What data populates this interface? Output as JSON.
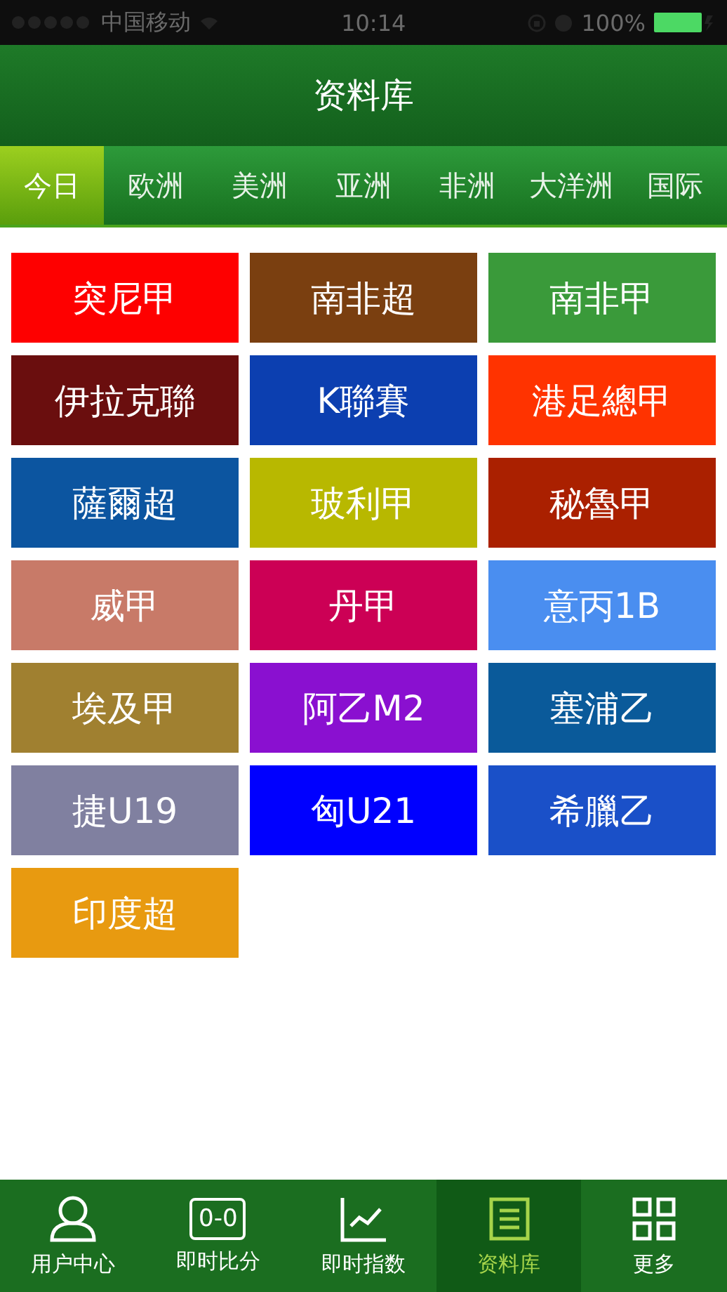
{
  "status_bar": {
    "carrier": "中国移动",
    "time": "10:14",
    "battery": "100%"
  },
  "header": {
    "title": "资料库"
  },
  "tabs": [
    {
      "label": "今日",
      "selected": true
    },
    {
      "label": "欧洲",
      "selected": false
    },
    {
      "label": "美洲",
      "selected": false
    },
    {
      "label": "亚洲",
      "selected": false
    },
    {
      "label": "非洲",
      "selected": false
    },
    {
      "label": "大洋洲",
      "selected": false
    },
    {
      "label": "国际",
      "selected": false
    }
  ],
  "leagues": [
    {
      "name": "突尼甲",
      "color": "#fe0000"
    },
    {
      "name": "南非超",
      "color": "#7a3f10"
    },
    {
      "name": "南非甲",
      "color": "#3a9a3a"
    },
    {
      "name": "伊拉克聯",
      "color": "#6a0e0e"
    },
    {
      "name": "K聯賽",
      "color": "#0c3fb0"
    },
    {
      "name": "港足總甲",
      "color": "#ff3300"
    },
    {
      "name": "薩爾超",
      "color": "#0c55a0"
    },
    {
      "name": "玻利甲",
      "color": "#b8b800"
    },
    {
      "name": "秘魯甲",
      "color": "#aa2000"
    },
    {
      "name": "威甲",
      "color": "#c87a68"
    },
    {
      "name": "丹甲",
      "color": "#cc0055"
    },
    {
      "name": "意丙1B",
      "color": "#4a8ef0"
    },
    {
      "name": "埃及甲",
      "color": "#a08030"
    },
    {
      "name": "阿乙M2",
      "color": "#8a10d0"
    },
    {
      "name": "塞浦乙",
      "color": "#0a5a9a"
    },
    {
      "name": "捷U19",
      "color": "#8080a0"
    },
    {
      "name": "匈U21",
      "color": "#0000ff"
    },
    {
      "name": "希臘乙",
      "color": "#1a50c8"
    },
    {
      "name": "印度超",
      "color": "#e89a10"
    }
  ],
  "bottom_nav": [
    {
      "kind": "user",
      "label": "用户中心",
      "selected": false
    },
    {
      "kind": "score",
      "label": "即时比分",
      "icon_text": "0-0",
      "selected": false
    },
    {
      "kind": "chart",
      "label": "即时指数",
      "selected": false
    },
    {
      "kind": "list",
      "label": "资料库",
      "selected": true
    },
    {
      "kind": "grid",
      "label": "更多",
      "selected": false
    }
  ]
}
